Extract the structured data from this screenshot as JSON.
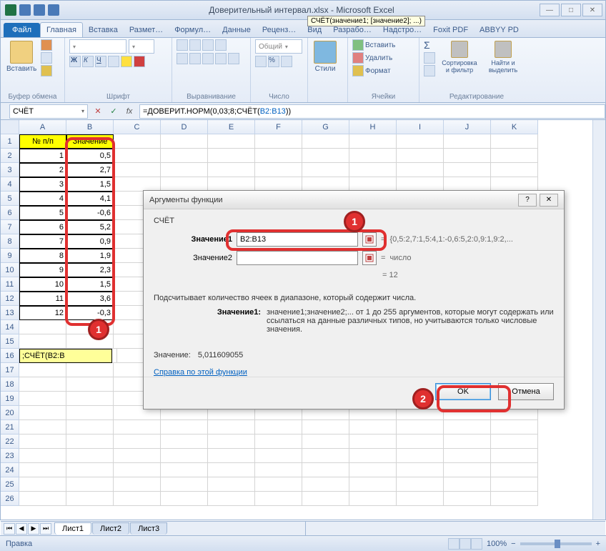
{
  "window": {
    "title": "Доверительный интервал.xlsx - Microsoft Excel"
  },
  "ribbon": {
    "tabs": [
      "Файл",
      "Главная",
      "Вставка",
      "Размет…",
      "Формул…",
      "Данные",
      "Реценз…",
      "Вид",
      "Разрабо…",
      "Надстро…",
      "Foxit PDF",
      "ABBYY PD"
    ],
    "active_tab_index": 1,
    "groups": {
      "clipboard": {
        "label": "Буфер обмена",
        "paste": "Вставить"
      },
      "font": {
        "label": "Шрифт"
      },
      "alignment": {
        "label": "Выравнивание"
      },
      "number": {
        "label": "Число",
        "format": "Общий"
      },
      "styles": {
        "label": "Стили",
        "btn": "Стили"
      },
      "cells": {
        "label": "Ячейки",
        "insert": "Вставить",
        "delete": "Удалить",
        "format": "Формат"
      },
      "editing": {
        "label": "Редактирование",
        "sort": "Сортировка и фильтр",
        "find": "Найти и выделить"
      }
    }
  },
  "formula_bar": {
    "name_box": "СЧЁТ",
    "formula_prefix": "=ДОВЕРИТ.НОРМ(0,03;8;СЧЁТ(",
    "formula_range": "B2:B13",
    "formula_suffix": "))",
    "tooltip": "СЧЁТ(значение1; [значение2]; ...)"
  },
  "sheet": {
    "columns": [
      "A",
      "B",
      "C",
      "D",
      "E",
      "F",
      "G",
      "H",
      "I",
      "J",
      "K"
    ],
    "headers": {
      "a": "№ п/п",
      "b": "Значение"
    },
    "rows": [
      {
        "n": "1",
        "v": "0,5"
      },
      {
        "n": "2",
        "v": "2,7"
      },
      {
        "n": "3",
        "v": "1,5"
      },
      {
        "n": "4",
        "v": "4,1"
      },
      {
        "n": "5",
        "v": "-0,6"
      },
      {
        "n": "6",
        "v": "5,2"
      },
      {
        "n": "7",
        "v": "0,9"
      },
      {
        "n": "8",
        "v": "1,9"
      },
      {
        "n": "9",
        "v": "2,3"
      },
      {
        "n": "10",
        "v": "1,5"
      },
      {
        "n": "11",
        "v": "3,6"
      },
      {
        "n": "12",
        "v": "-0,3"
      }
    ],
    "active_cell_a16": ";СЧЁТ(B2:B",
    "tabs": [
      "Лист1",
      "Лист2",
      "Лист3"
    ]
  },
  "dialog": {
    "title": "Аргументы функции",
    "fn_name": "СЧЁТ",
    "arg1_label": "Значение1",
    "arg1_value": "B2:B13",
    "arg1_preview": "{0,5:2,7:1,5:4,1:-0,6:5,2:0,9:1,9:2,...",
    "arg2_label": "Значение2",
    "arg2_value": "",
    "arg2_preview": "число",
    "mid_result": "= 12",
    "description": "Подсчитывает количество ячеек в диапазоне, который содержит числа.",
    "arg_desc_label": "Значение1:",
    "arg_desc_text": "значение1;значение2;... от 1 до 255 аргументов, которые могут содержать или ссылаться на данные различных типов, но учитываются только числовые значения.",
    "result_label": "Значение:",
    "result_value": "5,011609055",
    "help_link": "Справка по этой функции",
    "ok": "OK",
    "cancel": "Отмена"
  },
  "statusbar": {
    "mode": "Правка",
    "zoom": "100%"
  },
  "badges": {
    "one": "1",
    "two": "2"
  }
}
